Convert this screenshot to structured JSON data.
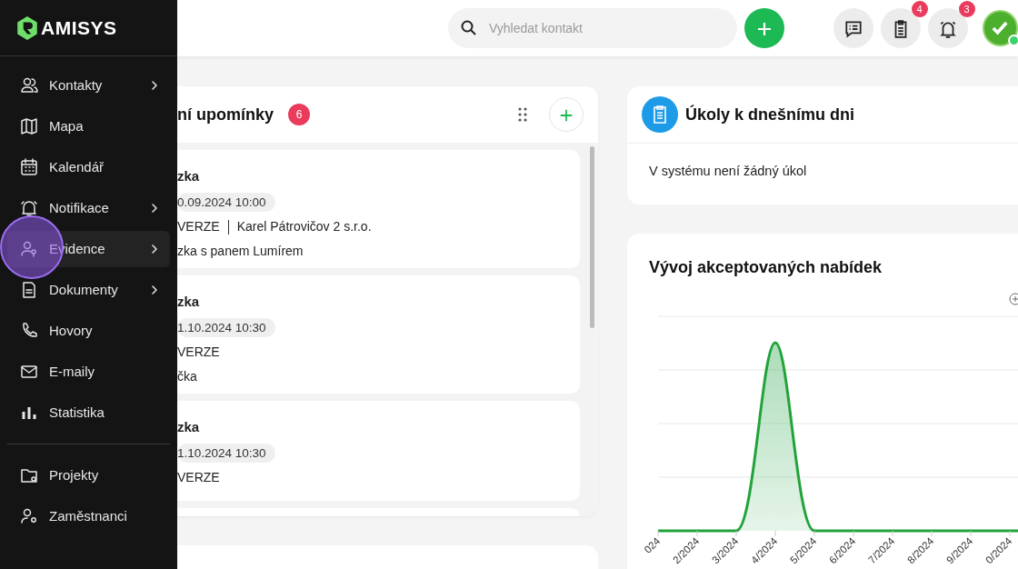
{
  "brand": {
    "name": "AMISYS"
  },
  "sidebar": {
    "items": [
      {
        "label": "Kontakty",
        "has_submenu": true,
        "selected": false
      },
      {
        "label": "Mapa",
        "has_submenu": false,
        "selected": false
      },
      {
        "label": "Kalendář",
        "has_submenu": false,
        "selected": false
      },
      {
        "label": "Notifikace",
        "has_submenu": true,
        "selected": false
      },
      {
        "label": "Evidence",
        "has_submenu": true,
        "selected": true
      },
      {
        "label": "Dokumenty",
        "has_submenu": true,
        "selected": false
      },
      {
        "label": "Hovory",
        "has_submenu": false,
        "selected": false
      },
      {
        "label": "E-maily",
        "has_submenu": false,
        "selected": false
      },
      {
        "label": "Statistika",
        "has_submenu": false,
        "selected": false
      }
    ],
    "footer_items": [
      {
        "label": "Projekty",
        "selected": false
      },
      {
        "label": "Zaměstnanci",
        "selected": false
      }
    ]
  },
  "header": {
    "search": {
      "placeholder": "Vyhledat kontakt"
    },
    "buttons": [
      {
        "kind": "messages"
      },
      {
        "kind": "tasks",
        "count": "4"
      },
      {
        "kind": "notifications",
        "count": "3"
      }
    ],
    "avatar": {
      "online": true
    }
  },
  "reminders": {
    "title": "ní upomínky",
    "count": "6",
    "items": [
      {
        "title": "zka",
        "date": "0.09.2024 10:00",
        "project": "VERZE",
        "company": "Karel Pátrovičov 2 s.r.o.",
        "note": "zka s panem Lumírem"
      },
      {
        "title": "zka",
        "date": "1.10.2024 10:30",
        "project": "VERZE",
        "note": "čka"
      },
      {
        "title": "zka",
        "date": "1.10.2024 10:30",
        "project": "VERZE"
      }
    ]
  },
  "tasks": {
    "title": "Úkoly k dnešnímu dni",
    "empty_text": "V systému není žádný úkol"
  },
  "chart": {
    "title": "Vývoj akceptovaných nabídek",
    "x_labels": [
      "024",
      "2/2024",
      "3/2024",
      "4/2024",
      "5/2024",
      "6/2024",
      "7/2024",
      "8/2024",
      "9/2024",
      "0/2024"
    ]
  }
}
